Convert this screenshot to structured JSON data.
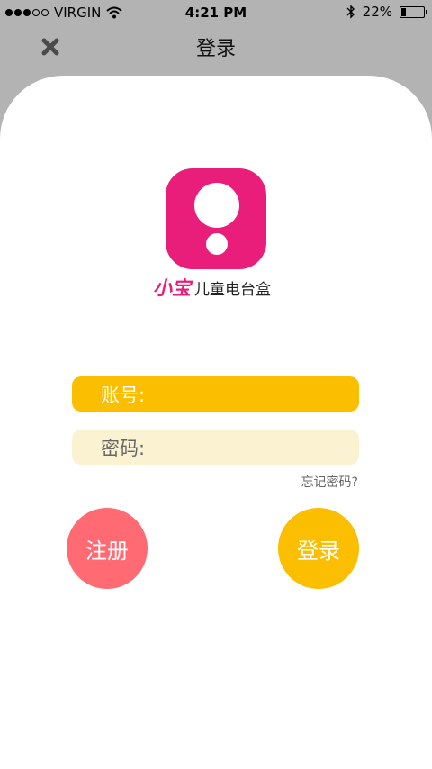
{
  "status_bar": {
    "carrier": "VIRGIN",
    "signal_bars_filled": 3,
    "signal_bars_total": 5,
    "time": "4:21 PM",
    "battery_percent": "22%",
    "battery_level": 0.22
  },
  "nav": {
    "title": "登录",
    "close_icon": "close-icon"
  },
  "brand": {
    "mark": "小宝",
    "subtitle": "儿童电台盒"
  },
  "form": {
    "account_label": "账号:",
    "account_value": "",
    "password_label": "密码:",
    "password_value": "",
    "forgot_label": "忘记密码?"
  },
  "buttons": {
    "register_label": "注册",
    "login_label": "登录"
  },
  "colors": {
    "background": "#b3b3b3",
    "brand_pink": "#e91e7a",
    "accent_yellow": "#fbbe00",
    "field_light": "#fbf2d2",
    "register_red": "#ff6a73"
  }
}
